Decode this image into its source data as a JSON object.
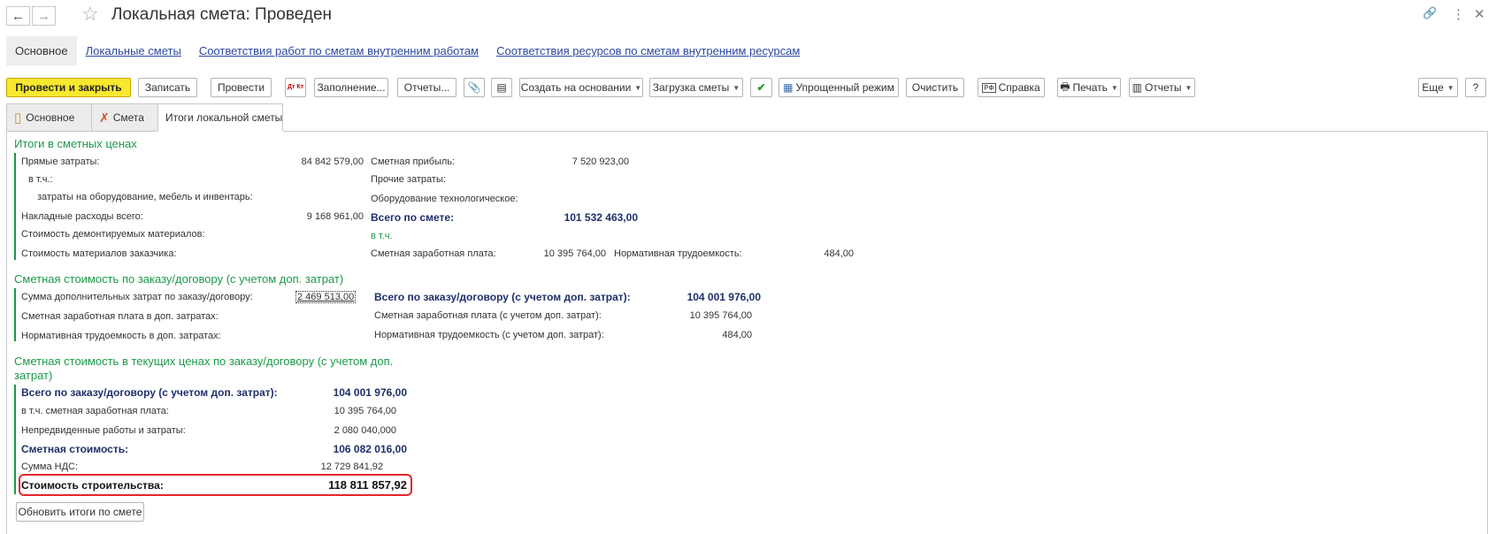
{
  "header": {
    "title": "Локальная смета: Проведен",
    "back_icon": "←",
    "forward_icon": "→",
    "star_icon": "☆",
    "link_icon": "🔗",
    "menu_icon": "⋮",
    "close_icon": "✕"
  },
  "nav": {
    "main": "Основное",
    "link1": "Локальные сметы",
    "link2": "Соответствия работ по сметам внутренним работам",
    "link3": "Соответствия ресурсов по сметам внутренним ресурсам"
  },
  "toolbar": {
    "post_close": "Провести и закрыть",
    "save": "Записать",
    "post": "Провести",
    "dtkt": "Дт Кт",
    "fill": "Заполнение...",
    "reports1": "Отчеты...",
    "create_based": "Создать на основании",
    "load_estimate": "Загрузка сметы",
    "simple_mode": "Упрощенный режим",
    "clear": "Очистить",
    "help": "Справка",
    "print": "Печать",
    "reports2": "Отчеты",
    "more": "Еще",
    "question": "?"
  },
  "tabs": {
    "main": "Основное",
    "estimate": "Смета",
    "totals": "Итоги локальной сметы"
  },
  "sec1": {
    "title": "Итоги в сметных ценах",
    "direct_costs_label": "Прямые затраты:",
    "direct_costs": "84 842 579,00",
    "incl_label": "в т.ч.:",
    "equipment_label": "затраты на оборудование, мебель и инвентарь:",
    "overhead_label": "Накладные расходы всего:",
    "overhead": "9 168 961,00",
    "dismantled_label": "Стоимость демонтируемых материалов:",
    "customer_materials_label": "Стоимость материалов заказчика:",
    "profit_label": "Сметная прибыль:",
    "profit": "7 520 923,00",
    "other_label": "Прочие затраты:",
    "tech_equipment_label": "Оборудование технологическое:",
    "total_label": "Всего по смете:",
    "total": "101 532 463,00",
    "incl2_label": "в т.ч.",
    "salary_label": "Сметная заработная плата:",
    "salary": "10 395 764,00",
    "labor_label": "Нормативная трудоемкость:",
    "labor": "484,00"
  },
  "sec2": {
    "title": "Сметная стоимость по заказу/договору (с учетом доп. затрат)",
    "extra_label": "Сумма дополнительных затрат по заказу/договору:",
    "extra": "2 469 513,00",
    "extra_salary_label": "Сметная заработная плата в доп. затратах:",
    "extra_labor_label": "Нормативная трудоемкость в доп. затратах:",
    "total_label": "Всего по заказу/договору (с учетом доп. затрат):",
    "total": "104 001 976,00",
    "salary_label": "Сметная заработная плата (с учетом доп. затрат):",
    "salary": "10 395 764,00",
    "labor_label": "Нормативная трудоемкость (с учетом доп. затрат):",
    "labor": "484,00"
  },
  "sec3": {
    "title_line1": "Сметная стоимость в текущих ценах по заказу/договору (с учетом доп.",
    "title_line2": "затрат)",
    "total_label": "Всего по заказу/договору (с учетом доп. затрат):",
    "total": "104 001 976,00",
    "salary_label": "в т.ч. сметная заработная плата:",
    "salary": "10 395 764,00",
    "contingency_label": "Непредвиденные работы и затраты:",
    "contingency": "2 080 040,000",
    "estimate_cost_label": "Сметная стоимость:",
    "estimate_cost": "106 082 016,00",
    "vat_label": "Сумма НДС:",
    "vat": "12 729 841,92",
    "construction_label": "Стоимость строительства:",
    "construction": "118 811 857,92"
  },
  "refresh_button": "Обновить итоги по смете"
}
